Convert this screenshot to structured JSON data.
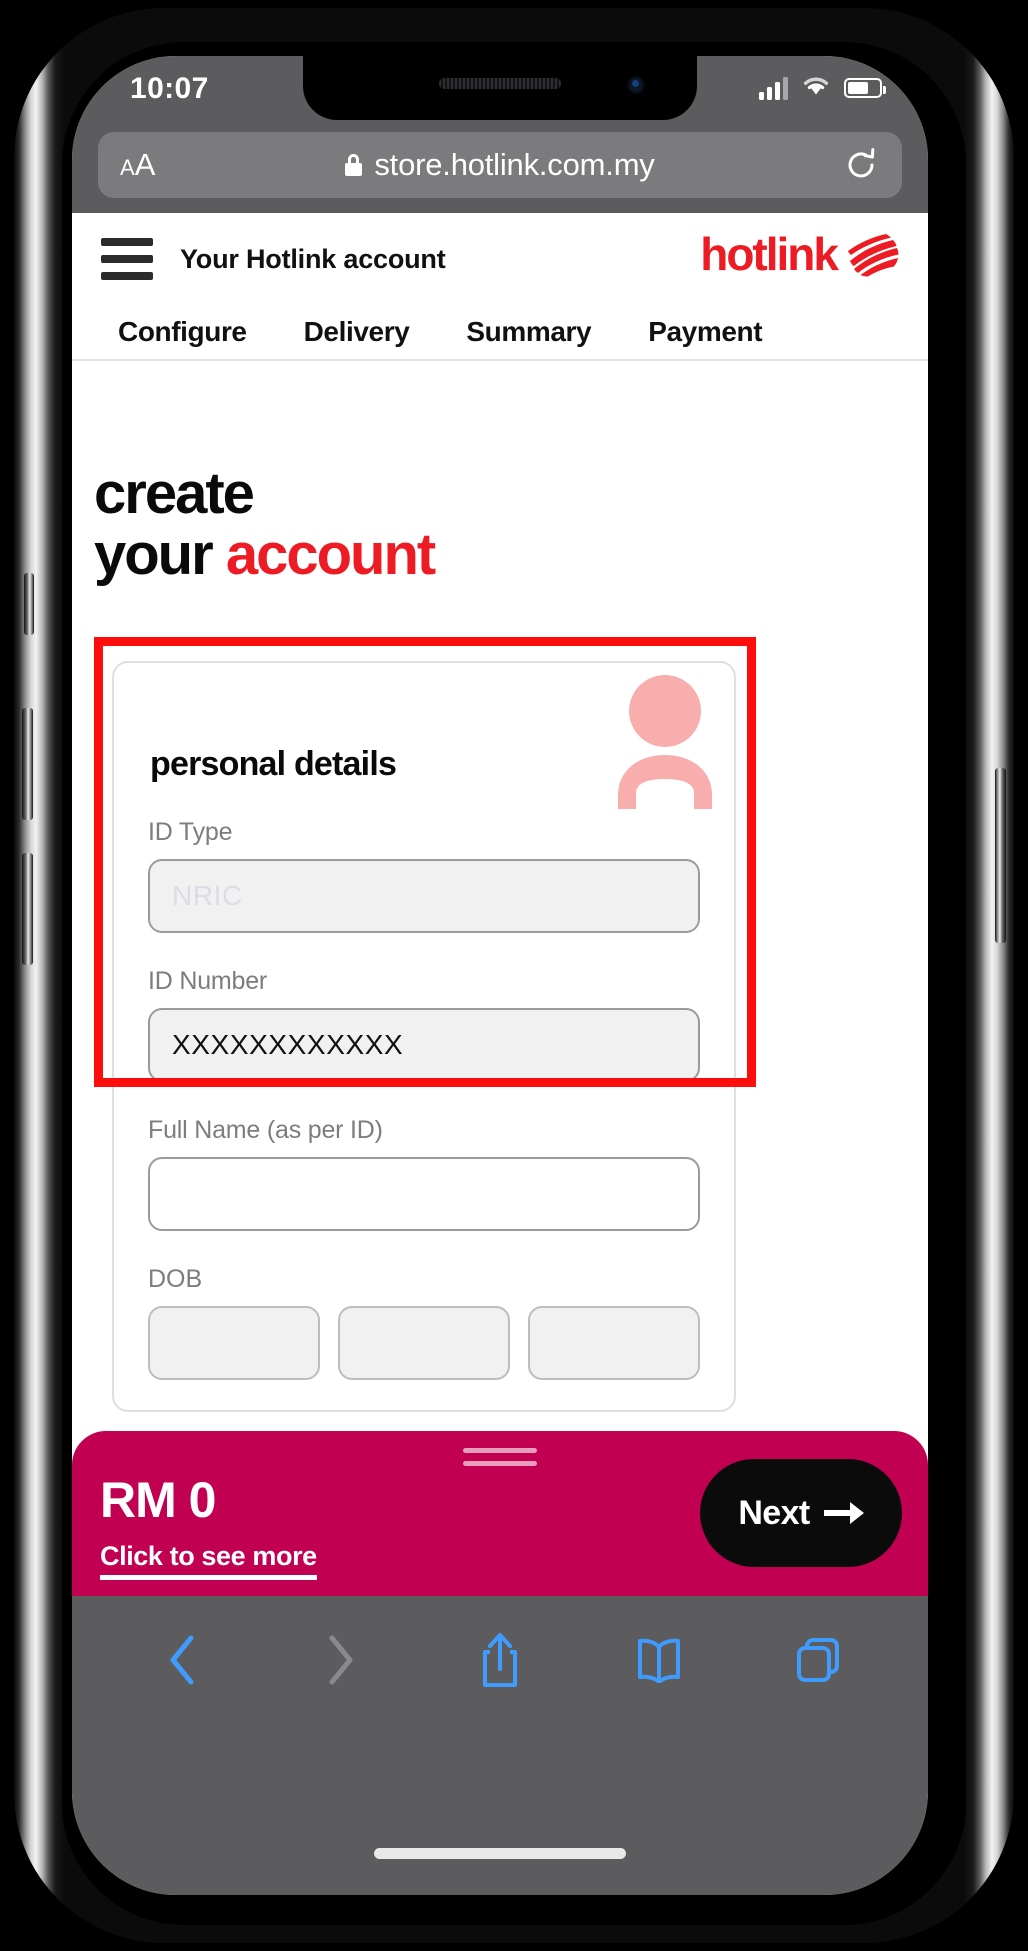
{
  "status_bar": {
    "time": "10:07",
    "signal_icon": "cellular-signal-icon",
    "wifi_icon": "wifi-icon",
    "battery_icon": "battery-icon"
  },
  "browser": {
    "aa_small": "A",
    "aa_big": "A",
    "lock_icon": "lock-icon",
    "url": "store.hotlink.com.my",
    "reload_icon": "reload-icon",
    "toolbar": {
      "back": "back-icon",
      "forward": "forward-icon",
      "share": "share-icon",
      "bookmarks": "bookmarks-icon",
      "tabs": "tabs-icon"
    }
  },
  "site": {
    "menu_icon": "hamburger-menu-icon",
    "account_title": "Your Hotlink account",
    "brand": "hotlink",
    "brand_color": "#ed1c24",
    "tabs": [
      {
        "label": "Configure"
      },
      {
        "label": "Delivery"
      },
      {
        "label": "Summary"
      },
      {
        "label": "Payment"
      }
    ]
  },
  "heading": {
    "line1": "create",
    "line2_plain": "your ",
    "line2_accent": "account"
  },
  "card": {
    "title": "personal details",
    "avatar_icon": "person-avatar-icon",
    "fields": [
      {
        "label": "ID Type",
        "value": "NRIC",
        "state": "disabled"
      },
      {
        "label": "ID Number",
        "value": "XXXXXXXXXXXX",
        "state": "filled"
      },
      {
        "label": "Full Name (as per ID)",
        "value": "",
        "state": "empty"
      }
    ],
    "dob_label": "DOB"
  },
  "action_bar": {
    "price": "RM 0",
    "see_more": "Click to see more",
    "next_label": "Next",
    "next_arrow_icon": "arrow-right-icon",
    "bar_color": "#c20052"
  }
}
